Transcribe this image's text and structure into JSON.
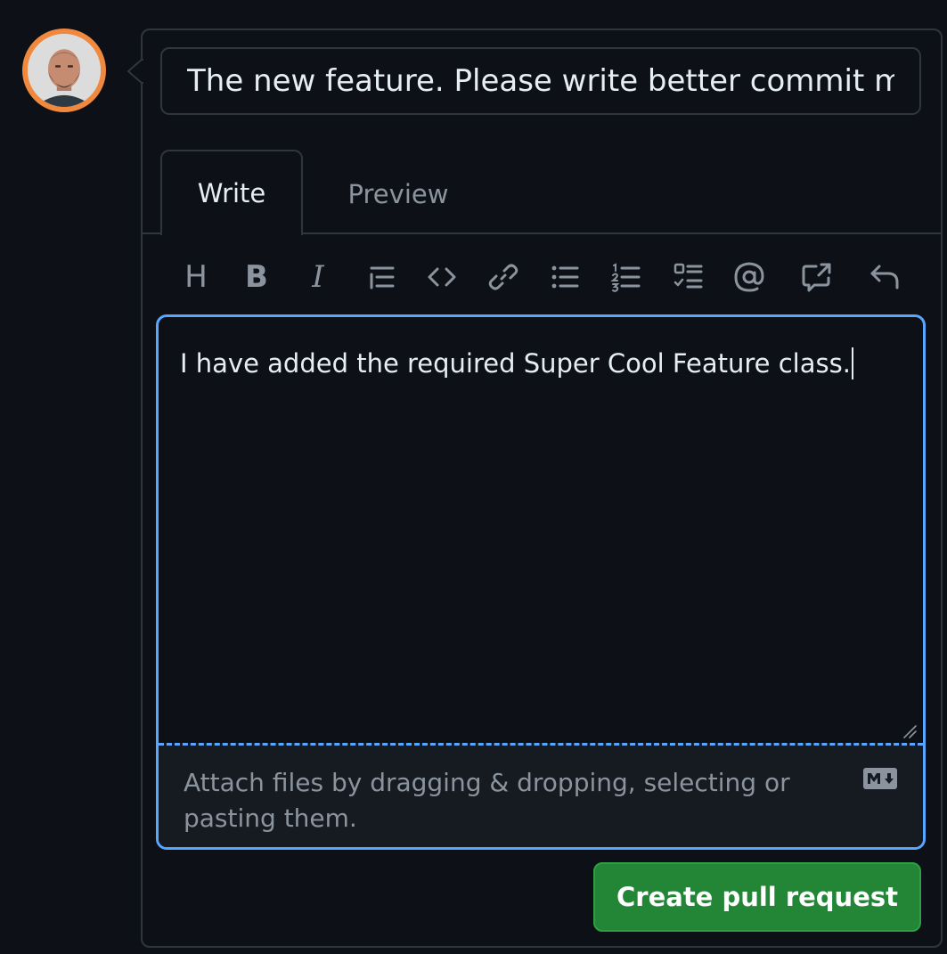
{
  "pull_request": {
    "title_value": "The new feature. Please write better commit me",
    "tabs": [
      {
        "label": "Write"
      },
      {
        "label": "Preview"
      }
    ],
    "toolbar": {
      "heading_glyph": "H",
      "bold_glyph": "B",
      "italic_glyph": "I",
      "icons": [
        "heading-icon",
        "bold-icon",
        "italic-icon",
        "quote-icon",
        "code-icon",
        "link-icon",
        "bulleted-list-icon",
        "numbered-list-icon",
        "task-list-icon",
        "mention-icon",
        "cross-reference-icon",
        "reply-icon"
      ]
    },
    "body_text": "I have added the required Super Cool Feature class.",
    "attach_hint": "Attach files by dragging & dropping, selecting or pasting them.",
    "markdown_badge_icon": "markdown-icon",
    "submit_label": "Create pull request"
  },
  "colors": {
    "background": "#0d1117",
    "border": "#30363d",
    "focus_blue": "#58a6ff",
    "avatar_ring": "#f0883e",
    "primary_button": "#238636",
    "muted_text": "#8b949e"
  }
}
